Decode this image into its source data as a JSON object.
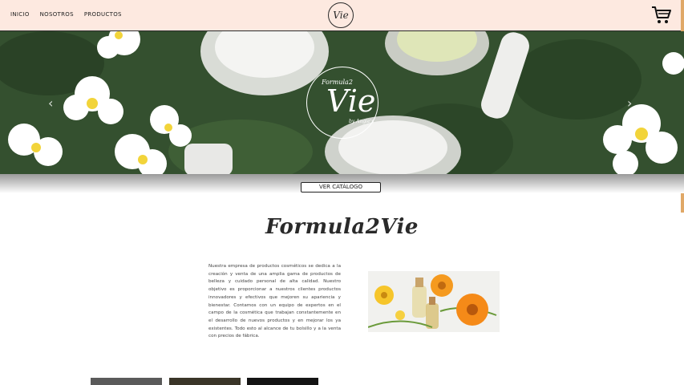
{
  "nav": {
    "links": [
      "INICIO",
      "NOSOTROS",
      "PRODUCTOS"
    ],
    "logo_text": "Vie",
    "cart_icon": "cart-icon"
  },
  "hero": {
    "logo_line1": "Formula2",
    "logo_line2": "Vie",
    "logo_line3": "by Angie's",
    "prev_arrow": "‹",
    "next_arrow": "›"
  },
  "catalog_button": "VER CATÁLOGO",
  "brand_title": "Formula2Vie",
  "about_text": "Nuestra empresa de productos cosméticos se dedica a la creación y venta de una amplia gama de productos de belleza y cuidado personal de alta calidad. Nuestro objetivo es proporcionar a nuestros clientes productos innovadores y efectivos que mejoren su apariencia y bienestar. Contamos con un equipo de expertos en el campo de la cosmética que trabajan constantemente en el desarrollo de nuevos productos y en mejorar los ya existentes. Todo esto al alcance de tu bolsillo y a la venta con precios de fábrica.",
  "colors": {
    "nav_bg": "#fde9e0",
    "accent_scrollbar": "#e0a867"
  }
}
